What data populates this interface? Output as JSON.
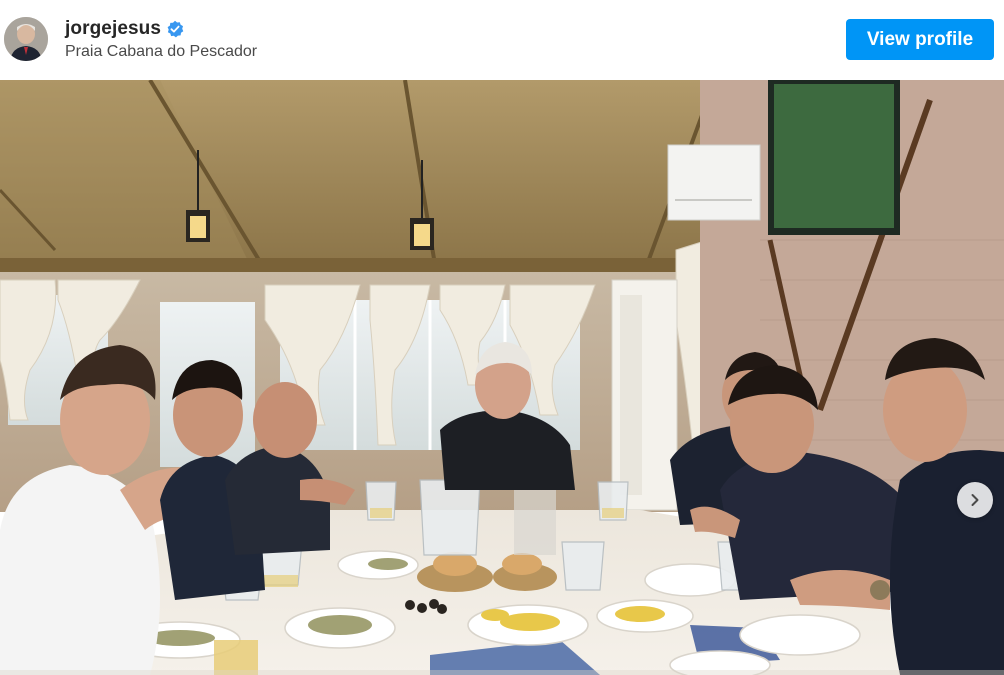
{
  "post_header": {
    "username": "jorgejesus",
    "verified": true,
    "location": "Praia Cabana do Pescador",
    "view_profile_label": "View profile"
  },
  "photo": {
    "alt": "Group lunch at a seaside restaurant table",
    "next_icon": "chevron-right-icon"
  },
  "colors": {
    "primary_button": "#0095f6",
    "verified_badge": "#3897f0",
    "username_text": "#262626"
  }
}
